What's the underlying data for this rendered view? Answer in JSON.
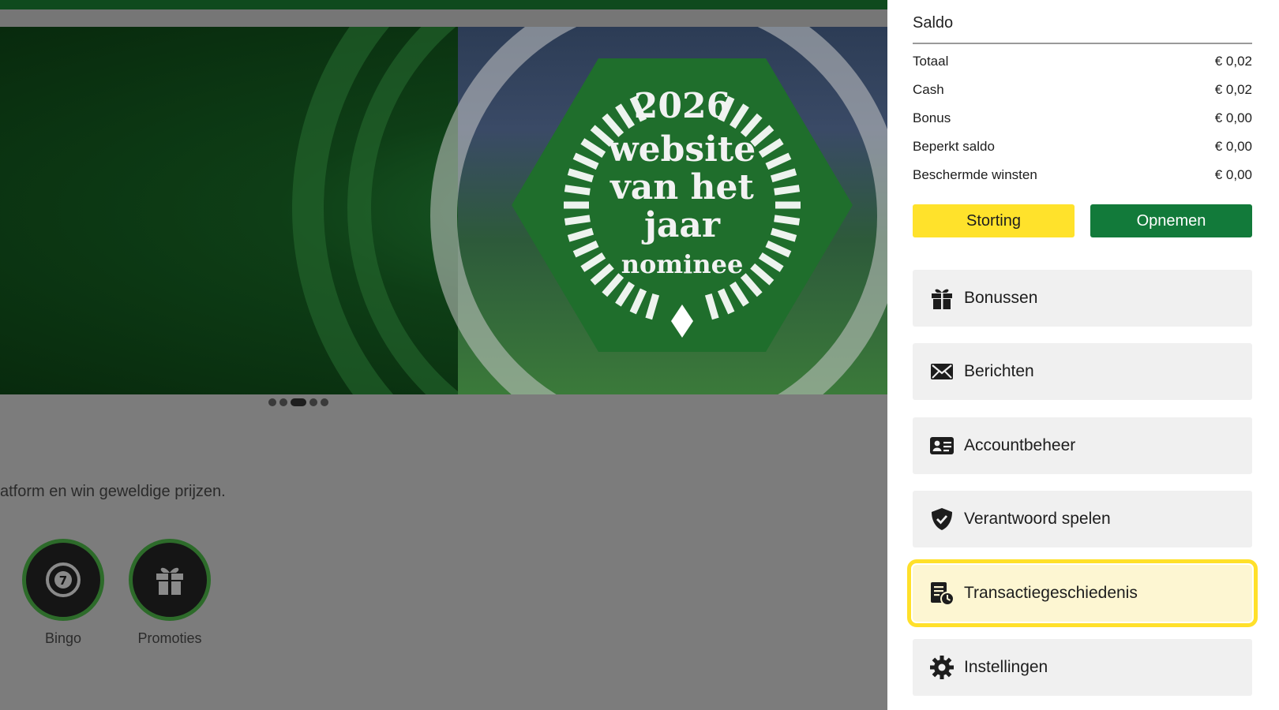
{
  "banner": {
    "badge_year": "2026",
    "badge_line1": "website",
    "badge_line2": "van het",
    "badge_line3": "jaar",
    "badge_line4": "nominee",
    "carousel_dots": 5,
    "carousel_active_index": 2
  },
  "tagline": "atform en win geweldige prijzen.",
  "quick_links": [
    {
      "label": "Bingo",
      "icon": "bingo-ball-icon"
    },
    {
      "label": "Promoties",
      "icon": "gift-icon"
    }
  ],
  "panel": {
    "title": "Saldo",
    "balances": [
      {
        "label": "Totaal",
        "value": "€ 0,02"
      },
      {
        "label": "Cash",
        "value": "€ 0,02"
      },
      {
        "label": "Bonus",
        "value": "€ 0,00"
      },
      {
        "label": "Beperkt saldo",
        "value": "€ 0,00"
      },
      {
        "label": "Beschermde winsten",
        "value": "€ 0,00"
      }
    ],
    "deposit_label": "Storting",
    "withdraw_label": "Opnemen",
    "menu": [
      {
        "label": "Bonussen",
        "icon": "gift-icon"
      },
      {
        "label": "Berichten",
        "icon": "envelope-icon"
      },
      {
        "label": "Accountbeheer",
        "icon": "id-card-icon"
      },
      {
        "label": "Verantwoord spelen",
        "icon": "shield-check-icon"
      },
      {
        "label": "Transactiegeschiedenis",
        "icon": "transaction-history-icon",
        "active": true
      },
      {
        "label": "Instellingen",
        "icon": "gear-icon"
      }
    ]
  },
  "colors": {
    "brand_green": "#127a3a",
    "deposit_yellow": "#ffe22b",
    "highlight_yellow": "#ffe02a"
  }
}
